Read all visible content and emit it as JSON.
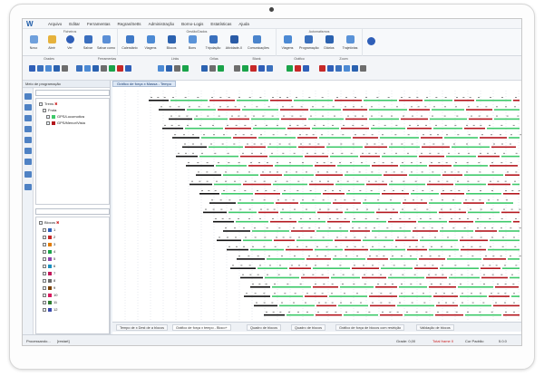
{
  "menu": [
    "Arquivo",
    "Editar",
    "Ferramentas",
    "Regras/Setts",
    "Administração",
    "Borno-Logis",
    "Estatísticas",
    "Ajuda"
  ],
  "ribbon": {
    "group_titles": [
      "Ficheiros",
      "Gestão/Dados",
      "Automatismos"
    ],
    "buttons": [
      "Novo",
      "Abrir",
      "Ver",
      "Salvar",
      "Salvar como",
      "Calendário",
      "Viagens",
      "Blocos",
      "Bons",
      "Tripulação",
      "Atividade-X",
      "Comunicações",
      "Viagens",
      "Programação",
      "Diários",
      "Trajetórias"
    ]
  },
  "toolbar2": {
    "group_titles": [
      "Grades",
      "Ferramentas",
      "Links",
      "Grilas",
      "Blank",
      "Gráfico",
      "Zoom"
    ]
  },
  "left_panel": {
    "title": "Meio de programação",
    "tree1": {
      "root": "Trens",
      "child": "Frota",
      "items": [
        "GPS/Locomotiva",
        "GPS/Menor/Vista"
      ]
    },
    "tree2": {
      "root": "Blocos",
      "items": [
        "1",
        "2",
        "3",
        "4",
        "5",
        "6",
        "7",
        "8",
        "9",
        "10",
        "11",
        "12"
      ],
      "colors": [
        "#2f5fb8",
        "#c62828",
        "#e07b00",
        "#1aa34a",
        "#8e44ad",
        "#1c8fbf",
        "#c2185b",
        "#6d6d6d",
        "#7b3f00",
        "#d81b60",
        "#2e7d32",
        "#3949ab"
      ]
    }
  },
  "chart": {
    "tab_title": "Gráfico de força x Massa - Tempo",
    "green": "#3ec96a",
    "red": "#b3161d",
    "black": "#111111"
  },
  "bottom_tabs": [
    "Tempo de x Dest de a blocos",
    "Gráfico de força x tempo - Bloco+",
    "Quadro de blocos",
    "Quadro de blocos",
    "Gráfico de força de blocos com restrição",
    "Validação de blocos"
  ],
  "status": {
    "left": "Processando...",
    "left2": "[restart]",
    "grade": "Grade: 0,00",
    "total": "Total frame 0",
    "padrao": "Cor Padrão",
    "version": "5.0.0"
  }
}
